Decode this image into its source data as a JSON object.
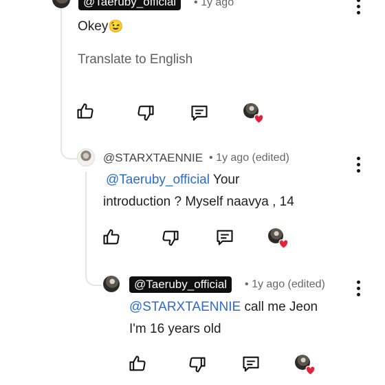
{
  "comment_top": {
    "handle": "@Taeruby_official",
    "time": "1y ago",
    "text": "Okey",
    "emoji": "😉",
    "translate_label": "Translate to English"
  },
  "reply1": {
    "handle": "@STARXTAENNIE",
    "meta": "1y ago (edited)",
    "mention": "@Taeruby_official",
    "line1_rest": "Your",
    "line2": "introduction ? Myself naavya  , 14"
  },
  "reply2": {
    "handle": "@Taeruby_official",
    "meta": "1y ago (edited)",
    "mention": "@STARXTAENNIE",
    "line1_rest": " call me Jeon",
    "line2": "I'm 16 years old"
  },
  "separator": "•",
  "colors": {
    "mention": "#2a6bd0",
    "heart": "#e0243a",
    "badge": "#0f0f0f"
  },
  "icons": [
    "thumbs-up-icon",
    "thumbs-down-icon",
    "reply-icon",
    "creator-heart-icon",
    "more-options-icon"
  ]
}
